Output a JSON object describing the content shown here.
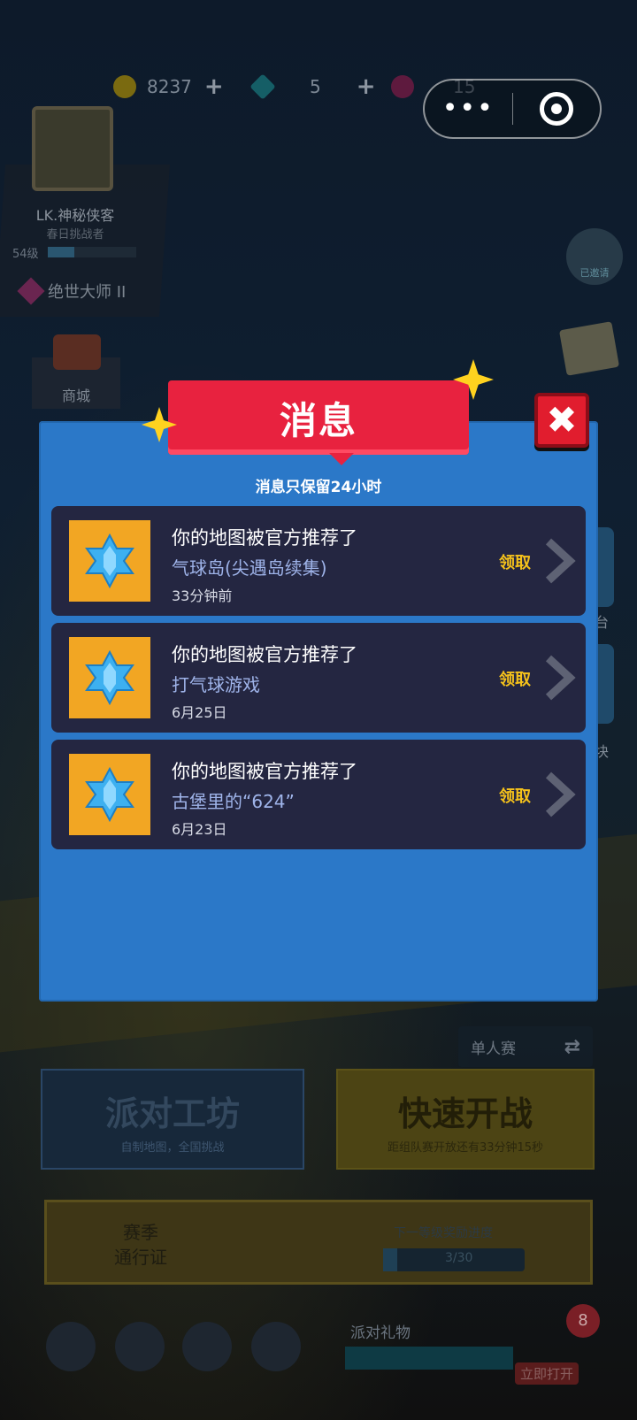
{
  "top_resources": {
    "coins": "8237",
    "diamonds": "5",
    "tickets": "15",
    "coin_color": "#e6b800",
    "diamond_color": "#1fb7c9",
    "ticket_color": "#c0307a"
  },
  "capsule": {
    "more_icon": "more-dots-icon",
    "close_icon": "target-icon"
  },
  "profile": {
    "name": "LK.神秘侠客",
    "subtitle": "春日挑战者",
    "level": "54级",
    "level_progress": 0.3,
    "rank": "绝世大师 II"
  },
  "shop": {
    "label": "商城"
  },
  "side_right": {
    "invited_label": "已邀请",
    "btn1_label": "台",
    "btn2_label": "块"
  },
  "modal": {
    "title": "消息",
    "subtitle": "消息只保留24小时",
    "close_label": "✖",
    "messages": [
      {
        "title": "你的地图被官方推荐了",
        "map": "气球岛(尖遇岛续集)",
        "time": "33分钟前",
        "action": "领取"
      },
      {
        "title": "你的地图被官方推荐了",
        "map": "打气球游戏",
        "time": "6月25日",
        "action": "领取"
      },
      {
        "title": "你的地图被官方推荐了",
        "map": "古堡里的“624”",
        "time": "6月23日",
        "action": "领取"
      }
    ]
  },
  "mode": {
    "label": "单人赛",
    "switch_icon": "switch-icon"
  },
  "workshop": {
    "title": "派对工坊",
    "subtitle": "自制地图，全国挑战"
  },
  "quick": {
    "title": "快速开战",
    "subtitle": "距组队赛开放还有33分钟15秒"
  },
  "pass": {
    "title_line1": "赛季",
    "title_line2": "通行证",
    "progress_label": "下一等级奖励进度",
    "progress": "3/30",
    "progress_fraction": 0.1
  },
  "bottom": {
    "gift_label": "派对礼物",
    "gift_open": "立即打开",
    "gift_badge": "8"
  },
  "colors": {
    "modal_bg": "#2b78c8",
    "banner_red": "#e8223f",
    "card_bg": "#242641",
    "claim_gold": "#f5c21b",
    "thumb_orange": "#f2a623"
  }
}
